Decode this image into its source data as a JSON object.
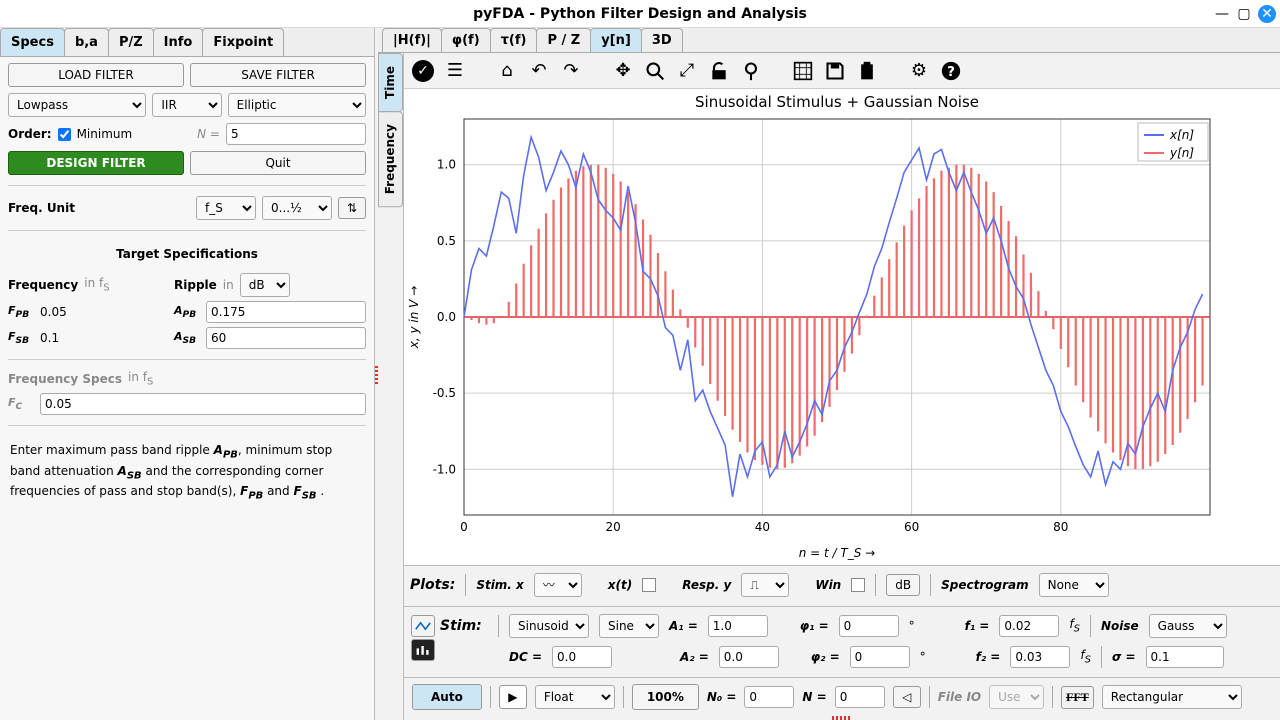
{
  "window": {
    "title": "pyFDA - Python Filter Design and Analysis"
  },
  "left_tabs": [
    "Specs",
    "b,a",
    "P/Z",
    "Info",
    "Fixpoint"
  ],
  "left_active_tab": 0,
  "buttons": {
    "load": "LOAD FILTER",
    "save": "SAVE FILTER",
    "design": "DESIGN FILTER",
    "quit": "Quit"
  },
  "filter": {
    "type": "Lowpass",
    "kind": "IIR",
    "method": "Elliptic",
    "order_label": "Order:",
    "minimum_checked": true,
    "minimum_label": "Minimum",
    "N_label": "N =",
    "N_value": "5"
  },
  "freq_unit": {
    "label": "Freq. Unit",
    "unit": "f_S",
    "range": "0...½"
  },
  "target": {
    "header": "Target Specifications",
    "freq_label": "Frequency",
    "freq_units": "in f<sub>S</sub>",
    "ripple_label": "Ripple",
    "ripple_units": "in",
    "ripple_unit_sel": "dB",
    "F_PB_label": "F<sub>PB</sub>",
    "F_PB": "0.05",
    "F_SB_label": "F<sub>SB</sub>",
    "F_SB": "0.1",
    "A_PB_label": "A<sub>PB</sub>",
    "A_PB": "0.175",
    "A_SB_label": "A<sub>SB</sub>",
    "A_SB": "60"
  },
  "freqspecs": {
    "header": "Frequency Specs",
    "units": "in f<sub>S</sub>",
    "FC_label": "F<sub>C</sub>",
    "FC": "0.05"
  },
  "help_text": "Enter maximum pass band ripple <b><i>A<sub>PB</sub></i></b>, minimum stop band attenuation <b><i>A<sub>SB</sub></i></b> and the corresponding corner frequencies of pass and stop band(s), <b><i>F<sub>PB</sub></i></b> and <b><i>F<sub>SB</sub></i></b> .",
  "plot_tabs": [
    "|H(f)|",
    "φ(f)",
    "τ(f)",
    "P / Z",
    "y[n]",
    "3D"
  ],
  "plot_active_tab": 4,
  "vertical_tabs": [
    "Time",
    "Frequency"
  ],
  "vertical_active": 0,
  "plots_bar": {
    "label": "Plots:",
    "stimx": "Stim. x",
    "xt": "x(t)",
    "respy": "Resp. y",
    "win": "Win",
    "db": "dB",
    "spectro": "Spectrogram",
    "spectro_val": "None"
  },
  "stim": {
    "label": "Stim:",
    "shape1": "Sinusoid",
    "shape2": "Sine",
    "A1_label": "A₁ =",
    "A1": "1.0",
    "A2_label": "A₂ =",
    "A2": "0.0",
    "DC_label": "DC =",
    "DC": "0.0",
    "phi1_label": "φ₁ =",
    "phi1": "0",
    "deg": "°",
    "phi2_label": "φ₂ =",
    "phi2": "0",
    "f1_label": "f₁ =",
    "f1": "0.02",
    "fs": "f<sub>S</sub>",
    "f2_label": "f₂ =",
    "f2": "0.03",
    "noise_label": "Noise",
    "noise": "Gauss",
    "sigma_label": "σ =",
    "sigma": "0.1"
  },
  "bottom": {
    "auto": "Auto",
    "format": "Float",
    "zoom": "100%",
    "N0_label": "N₀ =",
    "N0": "0",
    "N_label": "N =",
    "N": "0",
    "fileio": "File IO",
    "fileio_sel": "Use",
    "fft": "FFT",
    "window": "Rectangular"
  },
  "chart_data": {
    "type": "line+stem",
    "title": "Sinusoidal Stimulus + Gaussian Noise",
    "xlabel": "n = t / T_S →",
    "ylabel": "x, y in V →",
    "xlim": [
      0,
      100
    ],
    "ylim": [
      -1.3,
      1.3
    ],
    "xticks": [
      0,
      20,
      40,
      60,
      80
    ],
    "yticks": [
      -1.0,
      -0.5,
      0.0,
      0.5,
      1.0
    ],
    "legend": [
      {
        "name": "x[n]",
        "color": "#5a6ef0"
      },
      {
        "name": "y[n]",
        "color": "#f06a6a"
      }
    ],
    "series": [
      {
        "name": "x[n]",
        "kind": "line",
        "color": "#5a6ef0",
        "n_range": [
          0,
          99
        ],
        "formula": "sin(2π·0.02·n) + gaussian_noise(σ≈0.1)",
        "y_approx": [
          0.0,
          0.31,
          0.45,
          0.4,
          0.6,
          0.82,
          0.78,
          0.55,
          0.93,
          1.18,
          1.05,
          0.83,
          0.95,
          1.09,
          1.0,
          0.85,
          1.07,
          0.95,
          0.77,
          0.7,
          0.65,
          0.57,
          0.86,
          0.62,
          0.3,
          0.25,
          0.14,
          -0.07,
          -0.12,
          -0.35,
          -0.15,
          -0.55,
          -0.48,
          -0.62,
          -0.73,
          -0.84,
          -1.18,
          -0.9,
          -1.05,
          -0.88,
          -0.82,
          -1.05,
          -0.97,
          -0.75,
          -0.92,
          -0.82,
          -0.7,
          -0.55,
          -0.64,
          -0.42,
          -0.35,
          -0.2,
          -0.1,
          0.03,
          0.15,
          0.33,
          0.45,
          0.62,
          0.78,
          0.95,
          1.03,
          1.11,
          0.9,
          1.07,
          1.1,
          0.95,
          0.83,
          0.95,
          0.82,
          0.7,
          0.55,
          0.65,
          0.5,
          0.32,
          0.2,
          0.12,
          -0.05,
          -0.2,
          -0.35,
          -0.45,
          -0.62,
          -0.72,
          -0.85,
          -0.97,
          -1.05,
          -0.88,
          -1.1,
          -0.95,
          -1.0,
          -0.83,
          -0.9,
          -0.72,
          -0.6,
          -0.5,
          -0.62,
          -0.35,
          -0.2,
          -0.1,
          0.05,
          0.15
        ]
      },
      {
        "name": "y[n]",
        "kind": "stem",
        "color": "#f06a6a",
        "n_range": [
          0,
          99
        ],
        "formula": "filtered output, approx sin(2π·0.02·n − 0.8)",
        "y_approx": [
          0.0,
          -0.02,
          -0.04,
          -0.05,
          -0.04,
          0.0,
          0.1,
          0.22,
          0.35,
          0.47,
          0.58,
          0.68,
          0.77,
          0.85,
          0.91,
          0.96,
          0.99,
          1.0,
          1.0,
          0.98,
          0.94,
          0.89,
          0.82,
          0.74,
          0.64,
          0.54,
          0.42,
          0.3,
          0.18,
          0.05,
          -0.07,
          -0.2,
          -0.32,
          -0.44,
          -0.55,
          -0.65,
          -0.74,
          -0.82,
          -0.89,
          -0.94,
          -0.97,
          -0.99,
          -1.0,
          -0.99,
          -0.96,
          -0.91,
          -0.85,
          -0.78,
          -0.69,
          -0.59,
          -0.48,
          -0.36,
          -0.24,
          -0.12,
          0.01,
          0.14,
          0.26,
          0.38,
          0.49,
          0.6,
          0.7,
          0.78,
          0.86,
          0.91,
          0.96,
          0.98,
          1.0,
          1.0,
          0.98,
          0.94,
          0.89,
          0.82,
          0.73,
          0.63,
          0.53,
          0.41,
          0.29,
          0.17,
          0.04,
          -0.08,
          -0.21,
          -0.33,
          -0.45,
          -0.56,
          -0.66,
          -0.75,
          -0.83,
          -0.89,
          -0.94,
          -0.98,
          -1.0,
          -1.0,
          -0.98,
          -0.95,
          -0.9,
          -0.84,
          -0.76,
          -0.67,
          -0.56,
          -0.45
        ]
      }
    ]
  }
}
